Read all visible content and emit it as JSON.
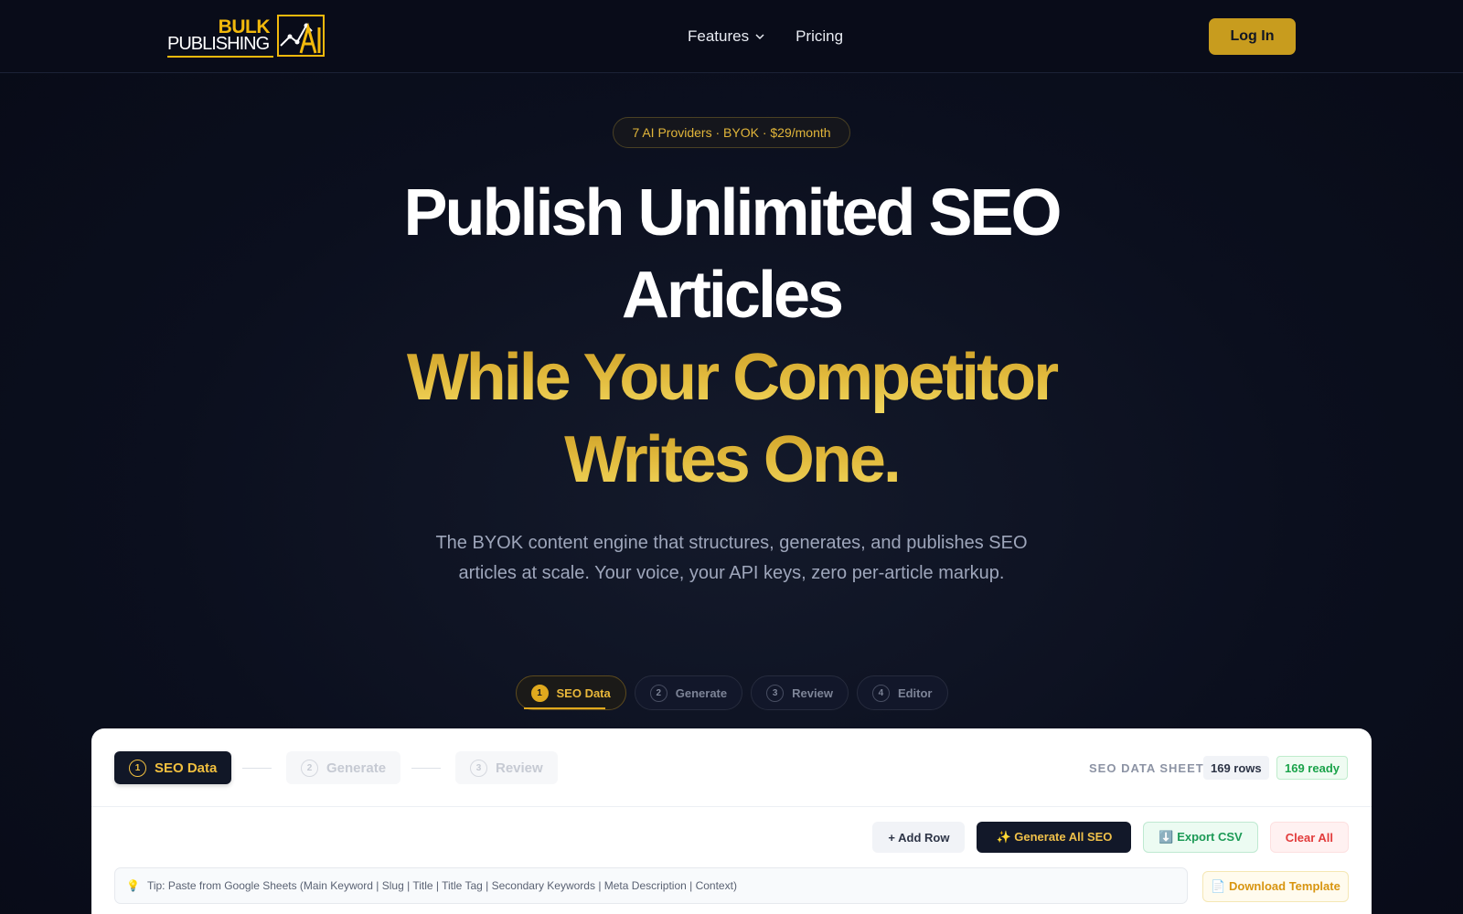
{
  "nav": {
    "logo_top": "BULK",
    "logo_bottom": "PUBLISHING",
    "logo_mark": "AI",
    "links": [
      {
        "label": "Features",
        "icon": "chevron-down-icon"
      },
      {
        "label": "Pricing"
      }
    ],
    "login_label": "Log In"
  },
  "hero": {
    "pill": "7 AI Providers · BYOK · $29/month",
    "headline_line1": "Publish Unlimited SEO",
    "headline_line2": "Articles",
    "headline_line3": "While Your Competitor",
    "headline_line4": "Writes One.",
    "subheadline": "The BYOK content engine that structures, generates, and publishes SEO articles at scale. Your voice, your API keys, zero per-article markup."
  },
  "steps": [
    {
      "num": "1",
      "label": "SEO Data",
      "active": true
    },
    {
      "num": "2",
      "label": "Generate",
      "active": false
    },
    {
      "num": "3",
      "label": "Review",
      "active": false
    },
    {
      "num": "4",
      "label": "Editor",
      "active": false
    }
  ],
  "card": {
    "steps": [
      {
        "num": "1",
        "label": "SEO Data"
      },
      {
        "num": "2",
        "label": "Generate"
      },
      {
        "num": "3",
        "label": "Review"
      }
    ],
    "sheet_label": "SEO DATA SHEET",
    "rows_badge": "169 rows",
    "ready_badge": "169 ready",
    "toolbar": {
      "add_row": "+ Add Row",
      "generate_all": "✨  Generate All SEO",
      "export_csv": "⬇️ Export CSV",
      "clear_all": "Clear All"
    },
    "tip_icon": "💡",
    "tip_text": "Tip: Paste from Google Sheets (Main Keyword | Slug | Title | Title Tag | Secondary Keywords | Meta Description | Context)",
    "download_template": "📄 Download Template"
  },
  "colors": {
    "accent_gold": "#e0a91e",
    "background": "#0b0f1e",
    "success": "#1ba34a",
    "danger": "#e23b3b"
  }
}
